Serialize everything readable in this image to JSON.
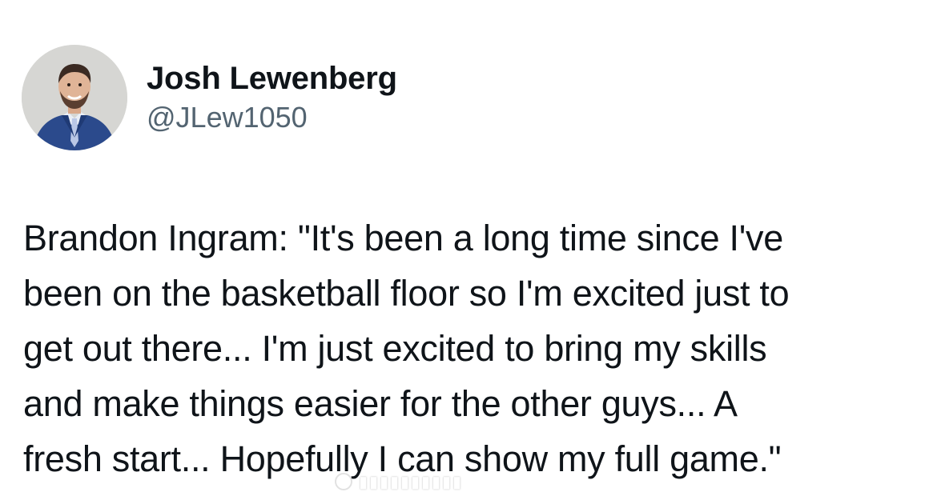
{
  "author": {
    "display_name": "Josh Lewenberg",
    "handle": "@JLew1050",
    "avatar_icon": "profile-photo"
  },
  "tweet": {
    "lines": [
      "Brandon Ingram: \"It's been a long time since I've",
      "been on the basketball floor so I'm excited just to",
      "get out there... I'm just excited to bring my skills",
      "and make things easier for the other guys... A",
      "fresh start... Hopefully I can show my full game.\""
    ]
  },
  "colors": {
    "text_primary": "#0f1419",
    "text_secondary": "#536471",
    "background": "#ffffff"
  }
}
